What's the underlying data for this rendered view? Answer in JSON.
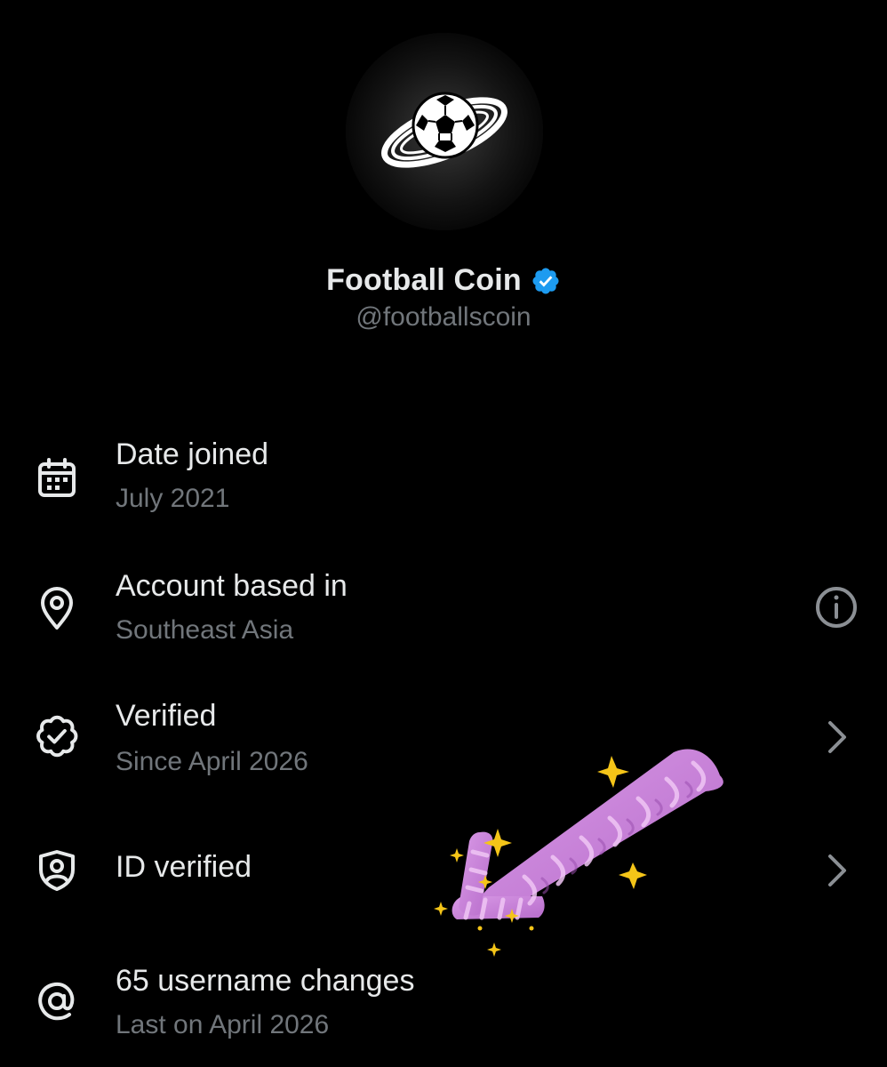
{
  "profile": {
    "display_name": "Football Coin",
    "handle": "@footballscoin",
    "avatar_icon": "football-swirl-logo",
    "badge_icon": "verified-checkmark-icon",
    "badge_color": "#1d9bf0"
  },
  "details": [
    {
      "icon": "calendar-icon",
      "title": "Date joined",
      "subtitle": "July 2021",
      "trailing": ""
    },
    {
      "icon": "location-pin-icon",
      "title": "Account based in",
      "subtitle": "Southeast Asia",
      "trailing": "info-icon"
    },
    {
      "icon": "verified-badge-icon",
      "title": "Verified",
      "subtitle": "Since April 2026",
      "trailing": "chevron-right-icon"
    },
    {
      "icon": "id-shield-icon",
      "title": "ID verified",
      "subtitle": "",
      "trailing": "chevron-right-icon"
    },
    {
      "icon": "at-sign-icon",
      "title": "65 username changes",
      "subtitle": "Last on April 2026",
      "trailing": ""
    }
  ],
  "overlay": {
    "sticker": "purple-sparkle-arrow-sticker",
    "colors": {
      "arrow": "#c77ddb",
      "sparkle": "#f5c518"
    }
  },
  "colors": {
    "background": "#000000",
    "primary_text": "#e7e9ea",
    "secondary_text": "#71767b",
    "icon": "#e7e9ea",
    "trailing_icon": "#8b8f94"
  }
}
